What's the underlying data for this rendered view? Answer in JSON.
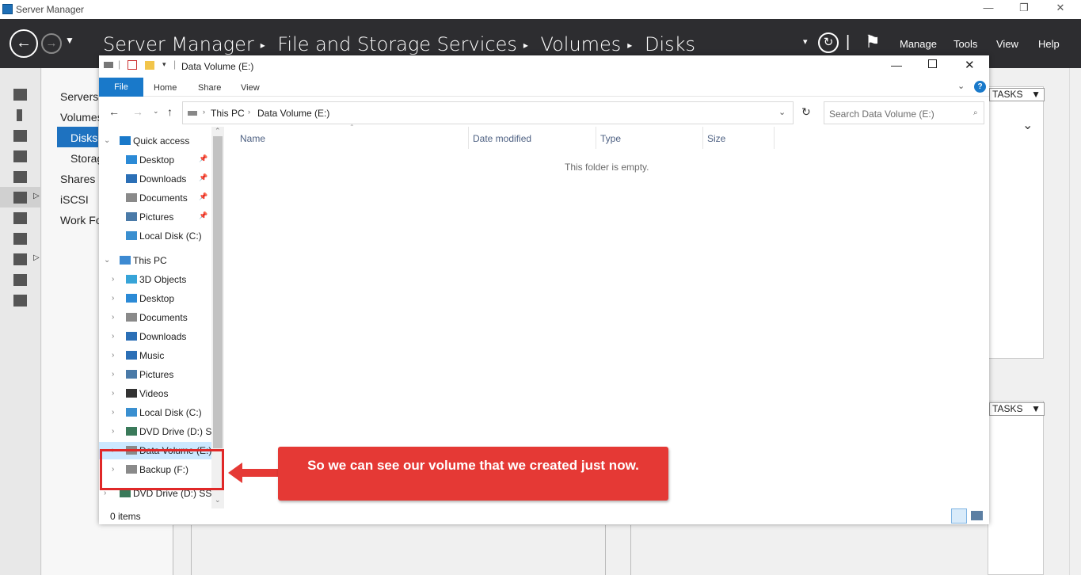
{
  "sm": {
    "title": "Server Manager",
    "breadcrumb": [
      "Server Manager",
      "File and Storage Services",
      "Volumes",
      "Disks"
    ],
    "menu": [
      "Manage",
      "Tools",
      "View",
      "Help"
    ],
    "nav": [
      "Servers",
      "Volumes",
      "Disks",
      "Storag",
      "Shares",
      "iSCSI",
      "Work Fo"
    ],
    "tasks": "TASKS"
  },
  "ex": {
    "title": "Data Volume (E:)",
    "tabs": {
      "file": "File",
      "home": "Home",
      "share": "Share",
      "view": "View"
    },
    "address": [
      "This PC",
      "Data Volume (E:)"
    ],
    "search_placeholder": "Search Data Volume (E:)",
    "columns": [
      "Name",
      "Date modified",
      "Type",
      "Size"
    ],
    "empty": "This folder is empty.",
    "status": "0 items",
    "tree": [
      {
        "label": "Quick access",
        "level": 0,
        "expand": "v",
        "icon": "star-icon",
        "pin": false
      },
      {
        "label": "Desktop",
        "level": 1,
        "expand": "",
        "icon": "desktop-icon",
        "pin": true
      },
      {
        "label": "Downloads",
        "level": 1,
        "expand": "",
        "icon": "downloads-icon",
        "pin": true
      },
      {
        "label": "Documents",
        "level": 1,
        "expand": "",
        "icon": "documents-icon",
        "pin": true
      },
      {
        "label": "Pictures",
        "level": 1,
        "expand": "",
        "icon": "pictures-icon",
        "pin": true
      },
      {
        "label": "Local Disk (C:)",
        "level": 1,
        "expand": "",
        "icon": "disk-icon",
        "pin": false
      },
      {
        "label": "This PC",
        "level": 0,
        "expand": "v",
        "icon": "pc-icon",
        "pin": false
      },
      {
        "label": "3D Objects",
        "level": 1,
        "expand": ">",
        "icon": "3d-objects-icon",
        "pin": false
      },
      {
        "label": "Desktop",
        "level": 1,
        "expand": ">",
        "icon": "desktop-icon",
        "pin": false
      },
      {
        "label": "Documents",
        "level": 1,
        "expand": ">",
        "icon": "documents-icon",
        "pin": false
      },
      {
        "label": "Downloads",
        "level": 1,
        "expand": ">",
        "icon": "downloads-icon",
        "pin": false
      },
      {
        "label": "Music",
        "level": 1,
        "expand": ">",
        "icon": "music-icon",
        "pin": false
      },
      {
        "label": "Pictures",
        "level": 1,
        "expand": ">",
        "icon": "pictures-icon",
        "pin": false
      },
      {
        "label": "Videos",
        "level": 1,
        "expand": ">",
        "icon": "videos-icon",
        "pin": false
      },
      {
        "label": "Local Disk (C:)",
        "level": 1,
        "expand": ">",
        "icon": "disk-icon",
        "pin": false
      },
      {
        "label": "DVD Drive (D:) SS",
        "level": 1,
        "expand": ">",
        "icon": "dvd-icon",
        "pin": false
      },
      {
        "label": "Data Volume (E:)",
        "level": 1,
        "expand": ">",
        "icon": "drive-icon",
        "pin": false,
        "selected": true
      },
      {
        "label": "Backup (F:)",
        "level": 1,
        "expand": ">",
        "icon": "drive-icon",
        "pin": false
      },
      {
        "label": "DVD Drive (D:) SSS",
        "level": 0,
        "expand": ">",
        "icon": "dvd-icon",
        "pin": false
      }
    ]
  },
  "callout": {
    "text": "So we can see our volume that we created just now."
  },
  "colors": {
    "accent": "#1979ca",
    "callout": "#e53935",
    "header": "#2d2d30"
  }
}
